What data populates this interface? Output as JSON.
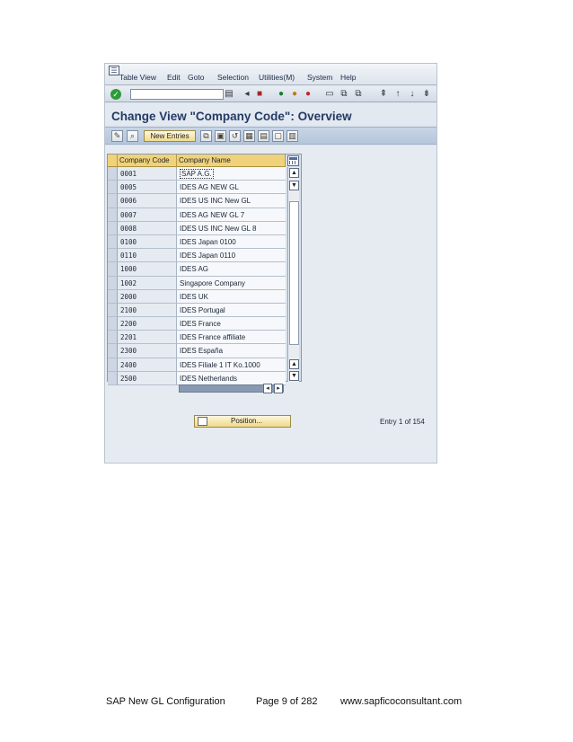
{
  "menubar": {
    "items": [
      "Table View",
      "Edit",
      "Goto",
      "Selection",
      "Utilities(M)",
      "System",
      "Help"
    ]
  },
  "toolbar": {
    "command_field_value": ""
  },
  "page_title": "Change View \"Company Code\": Overview",
  "app_toolbar": {
    "new_entries_label": "New Entries"
  },
  "table": {
    "columns": [
      "Company Code",
      "Company Name"
    ],
    "rows": [
      {
        "code": "0001",
        "name": "SAP A.G."
      },
      {
        "code": "0005",
        "name": "IDES AG NEW GL"
      },
      {
        "code": "0006",
        "name": "IDES US INC New GL"
      },
      {
        "code": "0007",
        "name": "IDES AG NEW GL 7"
      },
      {
        "code": "0008",
        "name": "IDES US INC New GL 8"
      },
      {
        "code": "0100",
        "name": "IDES Japan 0100"
      },
      {
        "code": "0110",
        "name": "IDES Japan 0110"
      },
      {
        "code": "1000",
        "name": "IDES AG"
      },
      {
        "code": "1002",
        "name": "Singapore Company"
      },
      {
        "code": "2000",
        "name": "IDES UK"
      },
      {
        "code": "2100",
        "name": "IDES Portugal"
      },
      {
        "code": "2200",
        "name": "IDES France"
      },
      {
        "code": "2201",
        "name": "IDES France affiliate"
      },
      {
        "code": "2300",
        "name": "IDES España"
      },
      {
        "code": "2400",
        "name": "IDES Filiale 1 IT Ko.1000"
      },
      {
        "code": "2500",
        "name": "IDES Netherlands"
      }
    ]
  },
  "position_button_label": "Position...",
  "entry_text": "Entry 1 of 154",
  "footer": {
    "doc_title": "SAP New GL Configuration",
    "page": "Page 9 of 282",
    "site": "www.sapficoconsultant.com"
  },
  "colors": {
    "header_gold": "#f0d27a",
    "title_blue": "#243a66",
    "toolbar_blue": "#c7d5e6"
  }
}
